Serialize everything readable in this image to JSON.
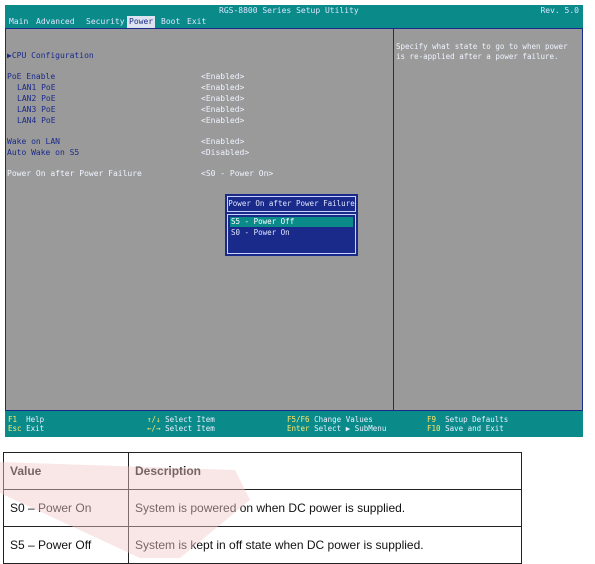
{
  "bios": {
    "title": "RGS-8800 Series Setup Utility",
    "revision": "Rev. 5.0",
    "menu": [
      "Main",
      "Advanced",
      "Security",
      "Power",
      "Boot",
      "Exit"
    ],
    "active_menu": "Power",
    "items": {
      "cpu_config": "▶CPU Configuration",
      "poe_enable": "PoE Enable",
      "lan1_poe": "LAN1 PoE",
      "lan2_poe": "LAN2 PoE",
      "lan3_poe": "LAN3 PoE",
      "lan4_poe": "LAN4 PoE",
      "wake_on_lan": "Wake on LAN",
      "auto_wake_s5": "Auto Wake on S5",
      "power_on_after_failure": "Power On after Power Failure"
    },
    "values": {
      "poe_enable": "<Enabled>",
      "lan1_poe": "<Enabled>",
      "lan2_poe": "<Enabled>",
      "lan3_poe": "<Enabled>",
      "lan4_poe": "<Enabled>",
      "wake_on_lan": "<Enabled>",
      "auto_wake_s5": "<Disabled>",
      "power_on_after_failure": "<S0 - Power On>"
    },
    "help_text": "Specify what state to go to when power is re-applied after a power failure.",
    "popup": {
      "title": "Power On after Power Failure",
      "options": [
        "S5 - Power Off",
        "S0 - Power On"
      ],
      "selected": "S5 - Power Off"
    },
    "footer": {
      "f1_key": "F1",
      "f1_label": "Help",
      "esc_key": "Esc",
      "esc_label": "Exit",
      "select_item_key": "↑/↓",
      "select_item_label": "Select Item",
      "select_menu_key": "←/→",
      "select_menu_label": "Select Item",
      "f5f6_key": "F5/F6",
      "f5f6_label": "Change Values",
      "enter_key": "Enter",
      "enter_label": "Select ▶ SubMenu",
      "f9_key": "F9",
      "f9_label": "Setup Defaults",
      "f10_key": "F10",
      "f10_label": "Save and Exit"
    }
  },
  "table": {
    "headers": [
      "Value",
      "Description"
    ],
    "rows": [
      [
        "S0 – Power On",
        "System is powered on when DC power is supplied."
      ],
      [
        "S5 – Power Off",
        "System is kept in off state when DC power is supplied."
      ]
    ]
  },
  "colors": {
    "bios_bg": "#9a9a9a",
    "bar_bg": "#0b8a8a",
    "item_text": "#1a2a8a",
    "value_text": "#f0f4ff"
  }
}
